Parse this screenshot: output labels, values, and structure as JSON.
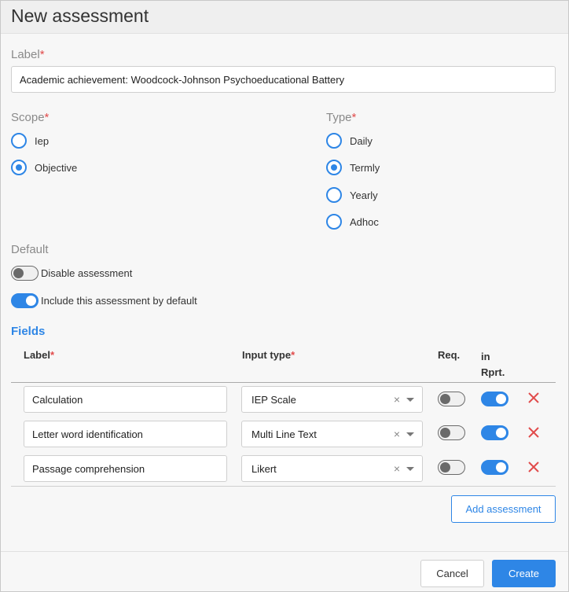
{
  "dialog": {
    "title": "New assessment"
  },
  "form": {
    "required_mark": "*",
    "label_field": {
      "label": "Label",
      "value": "Academic achievement: Woodcock-Johnson Psychoeducational Battery"
    },
    "scope": {
      "label": "Scope",
      "options": [
        {
          "label": "Iep",
          "checked": false
        },
        {
          "label": "Objective",
          "checked": true
        }
      ]
    },
    "type": {
      "label": "Type",
      "options": [
        {
          "label": "Daily",
          "checked": false
        },
        {
          "label": "Termly",
          "checked": true
        },
        {
          "label": "Yearly",
          "checked": false
        },
        {
          "label": "Adhoc",
          "checked": false
        }
      ]
    },
    "default": {
      "label": "Default",
      "toggles": [
        {
          "label": "Disable assessment",
          "on": false
        },
        {
          "label": "Include this assessment by default",
          "on": true
        }
      ]
    }
  },
  "fields": {
    "title": "Fields",
    "columns": {
      "label": "Label",
      "input_type": "Input type",
      "req": "Req.",
      "in_rprt_line1": "in",
      "in_rprt_line2": "Rprt."
    },
    "clear_glyph": "×",
    "rows": [
      {
        "label": "Calculation",
        "input_type": "IEP Scale",
        "req": false,
        "in_report": true
      },
      {
        "label": "Letter word identification",
        "input_type": "Multi Line Text",
        "req": false,
        "in_report": true
      },
      {
        "label": "Passage comprehension",
        "input_type": "Likert",
        "req": false,
        "in_report": true
      }
    ],
    "add_button": "Add assessment"
  },
  "footer": {
    "cancel": "Cancel",
    "create": "Create"
  },
  "colors": {
    "accent": "#2e86e6",
    "required": "#e14b4b",
    "delete": "#e14b4b"
  },
  "icons": {
    "delete": "close-x-icon",
    "select_clear": "clear-icon",
    "select_caret": "chevron-down-icon"
  }
}
